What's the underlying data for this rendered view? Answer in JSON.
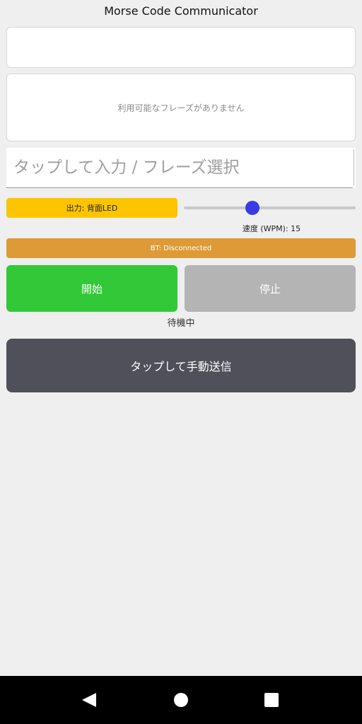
{
  "app": {
    "title": "Morse Code Communicator"
  },
  "phrases": {
    "empty_text": "利用可能なフレーズがありません"
  },
  "input": {
    "placeholder": "タップして入力 / フレーズ選択",
    "value": ""
  },
  "output": {
    "label": "出力: 背面LED"
  },
  "speed": {
    "label": "速度 (WPM): 15",
    "wpm": 15,
    "slider_fraction": 0.4
  },
  "bluetooth": {
    "status_label": "BT: Disconnected"
  },
  "controls": {
    "start_label": "開始",
    "stop_label": "停止",
    "status_text": "待機中"
  },
  "manual": {
    "send_label": "タップして手動送信"
  },
  "navbar": {
    "back_icon": "back-triangle-icon",
    "home_icon": "home-circle-icon",
    "recents_icon": "recents-square-icon"
  },
  "colors": {
    "output_button": "#fcc500",
    "slider_thumb": "#3a3ae8",
    "bt_status": "#dd9a36",
    "start": "#32c837",
    "stop": "#b4b4b4",
    "manual_send": "#50505a"
  }
}
